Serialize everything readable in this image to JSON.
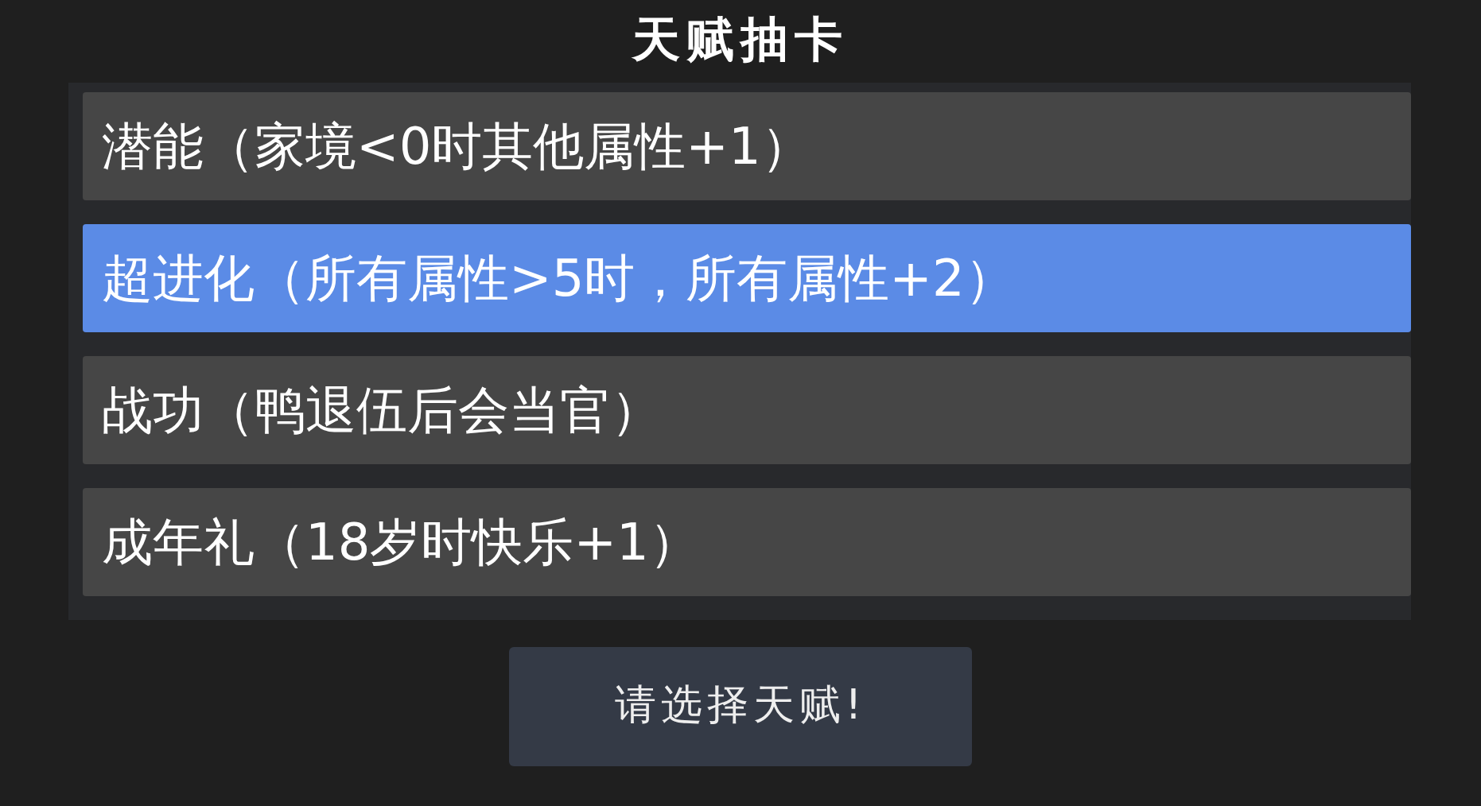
{
  "title": "天赋抽卡",
  "talents": [
    {
      "label": "潜能（家境<0时其他属性+1）",
      "selected": false
    },
    {
      "label": "超进化（所有属性>5时，所有属性+2）",
      "selected": true
    },
    {
      "label": "战功（鸭退伍后会当官）",
      "selected": false
    },
    {
      "label": "成年礼（18岁时快乐+1）",
      "selected": false
    }
  ],
  "button": "请选择天赋!"
}
